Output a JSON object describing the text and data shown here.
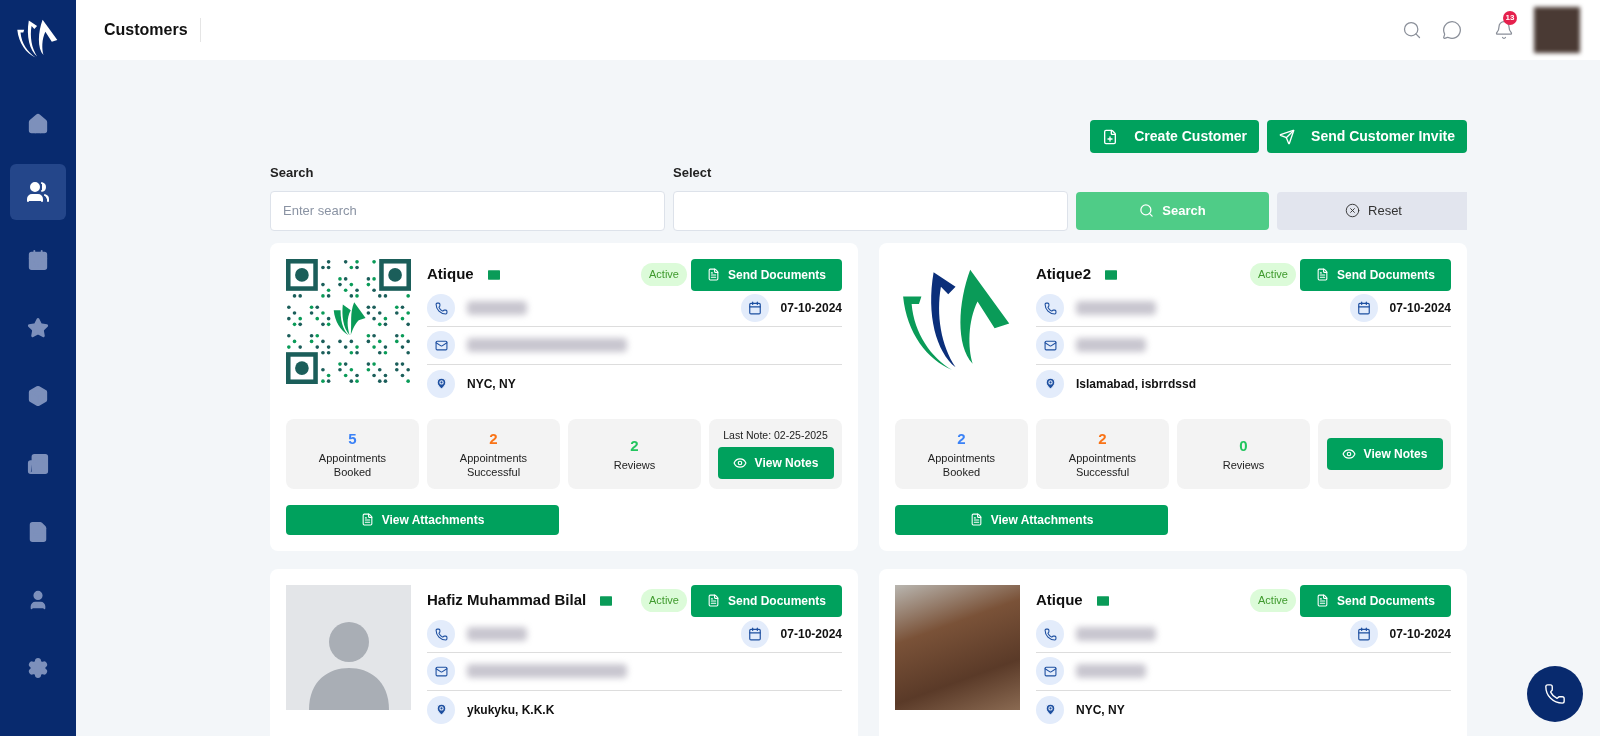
{
  "header": {
    "title": "Customers",
    "notification_count": "13"
  },
  "sidebar": {
    "items": [
      {
        "selected": false
      },
      {
        "selected": true
      },
      {
        "selected": false
      },
      {
        "selected": false
      },
      {
        "selected": false
      },
      {
        "selected": false
      },
      {
        "selected": false
      },
      {
        "selected": false
      },
      {
        "selected": false
      }
    ]
  },
  "actions": [
    {
      "label": "Create Customer"
    },
    {
      "label": "Send Customer Invite"
    }
  ],
  "filters": {
    "search_label": "Search",
    "search_placeholder": "Enter search",
    "select_label": "Select",
    "search_button": "Search",
    "reset_button": "Reset"
  },
  "customers": [
    {
      "name": "Atique",
      "kind": "qr",
      "status": "Active",
      "send_button": "Send Documents",
      "date": "07-10-2024",
      "location": "NYC, NY",
      "stats": [
        {
          "value": "5",
          "label": "Appointments Booked",
          "color": "#3b82f6"
        },
        {
          "value": "2",
          "label": "Appointments Successful",
          "color": "#f97316"
        },
        {
          "value": "2",
          "label": "Reviews",
          "color": "#22c55e"
        }
      ],
      "last_note": "Last Note: 02-25-2025",
      "notes_button": "View Notes",
      "attachments_button": "View Attachments"
    },
    {
      "name": "Atique2",
      "kind": "logo",
      "status": "Active",
      "send_button": "Send Documents",
      "date": "07-10-2024",
      "location": "Islamabad, isbrrdssd",
      "stats": [
        {
          "value": "2",
          "label": "Appointments Booked",
          "color": "#3b82f6"
        },
        {
          "value": "2",
          "label": "Appointments Successful",
          "color": "#f97316"
        },
        {
          "value": "0",
          "label": "Reviews",
          "color": "#22c55e"
        }
      ],
      "notes_button": "View Notes",
      "attachments_button": "View Attachments"
    },
    {
      "name": "Hafiz Muhammad Bilal",
      "kind": "avatar",
      "status": "Active",
      "send_button": "Send Documents",
      "date": "07-10-2024",
      "location": "ykukyku, K.K.K"
    },
    {
      "name": "Atique",
      "kind": "photo",
      "status": "Active",
      "send_button": "Send Documents",
      "date": "07-10-2024",
      "location": "NYC, NY"
    }
  ]
}
